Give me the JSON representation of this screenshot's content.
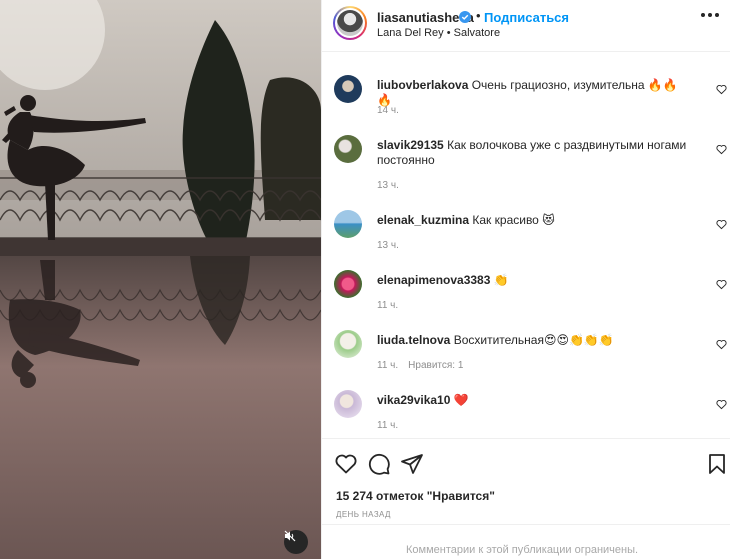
{
  "post": {
    "username": "liasanutiasheva",
    "separator": "•",
    "follow_label": "Подписаться",
    "location": "Lana Del Rey • Salvatore"
  },
  "comments": [
    {
      "user": "liubovberlakova",
      "text": "Очень грациозно, изумительна 🔥🔥🔥",
      "time": "14 ч.",
      "likes": ""
    },
    {
      "user": "slavik29135",
      "text": "Как волочкова уже с раздвинутыми ногами постоянно",
      "time": "13 ч.",
      "likes": ""
    },
    {
      "user": "elenak_kuzmina",
      "text": "Как красиво 😻",
      "time": "13 ч.",
      "likes": ""
    },
    {
      "user": "elenapimenova3383",
      "text": "👏",
      "time": "11 ч.",
      "likes": ""
    },
    {
      "user": "liuda.telnova",
      "text": "Восхитительная😍😍👏👏👏",
      "time": "11 ч.",
      "likes": "Нравится: 1"
    },
    {
      "user": "vika29vika10",
      "text": "❤️",
      "time": "11 ч.",
      "likes": ""
    }
  ],
  "likes_count": "15 274 отметок \"Нравится\"",
  "date": "ДЕНЬ НАЗАД",
  "comments_restricted": "Комментарии к этой публикации ограничены.",
  "icons": [
    "verified-badge-icon",
    "more-options-icon",
    "heart-icon",
    "comment-icon",
    "share-icon",
    "bookmark-icon",
    "audio-muted-icon"
  ],
  "colors": {
    "link_blue": "#0095f6",
    "text": "#262626",
    "secondary": "#8e8e8e",
    "border": "#efefef"
  }
}
